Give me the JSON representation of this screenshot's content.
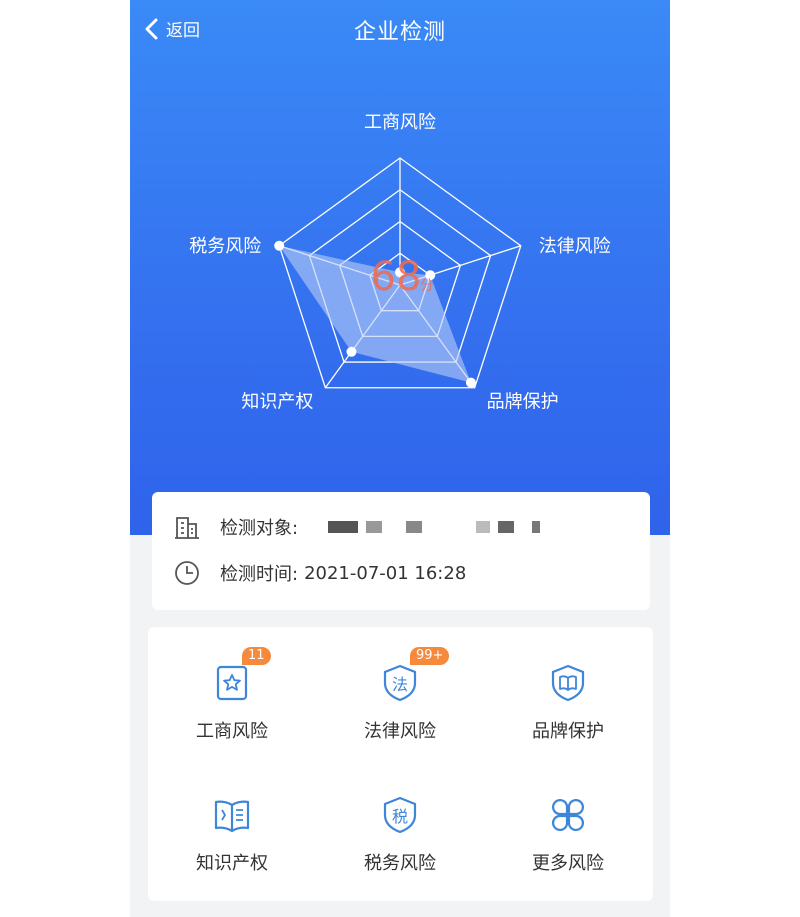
{
  "header": {
    "back_label": "返回",
    "title": "企业检测"
  },
  "radar": {
    "score": "68",
    "unit": "分",
    "axes": [
      {
        "label": "工商风险",
        "value": 0.1
      },
      {
        "label": "法律风险",
        "value": 0.25
      },
      {
        "label": "品牌保护",
        "value": 0.95
      },
      {
        "label": "知识产权",
        "value": 0.65
      },
      {
        "label": "税务风险",
        "value": 1.0
      }
    ],
    "colors": {
      "grid": "#ffffff",
      "fill": "#b9cdf7",
      "dot": "#ffffff"
    }
  },
  "info": {
    "target_label": "检测对象:",
    "time_label": "检测时间:",
    "time_value": "2021-07-01 16:28"
  },
  "risks": [
    {
      "name": "工商风险",
      "badge": "11",
      "icon": "star-card-icon"
    },
    {
      "name": "法律风险",
      "badge": "99+",
      "icon": "law-shield-icon"
    },
    {
      "name": "品牌保护",
      "badge": "",
      "icon": "book-shield-icon"
    },
    {
      "name": "知识产权",
      "badge": "",
      "icon": "open-book-icon"
    },
    {
      "name": "税务风险",
      "badge": "",
      "icon": "tax-shield-icon"
    },
    {
      "name": "更多风险",
      "badge": "",
      "icon": "four-petal-icon"
    }
  ],
  "colors": {
    "accent": "#3a7cf2",
    "icon": "#3d86d9",
    "badge": "#f58a3c"
  }
}
